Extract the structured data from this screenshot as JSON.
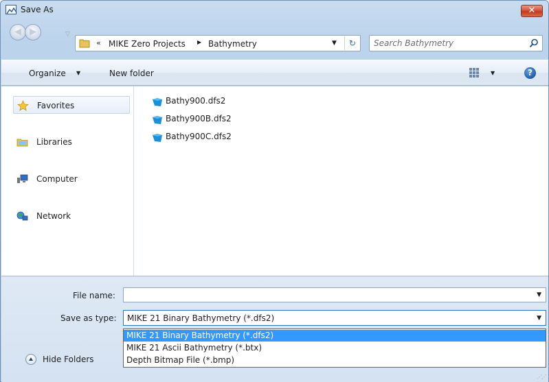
{
  "window": {
    "title": "Save As",
    "close_glyph": "✕",
    "icon": "save-as-app-icon"
  },
  "address": {
    "overflow_glyph": "«",
    "crumbs": [
      "MIKE Zero Projects",
      "Bathymetry"
    ],
    "separator_glyph": "▶",
    "dropdown_glyph": "▼",
    "refresh_glyph": "↻"
  },
  "search": {
    "placeholder": "Search Bathymetry"
  },
  "toolbar": {
    "organize_label": "Organize",
    "organize_arrow": "▼",
    "new_folder_label": "New folder",
    "views_arrow": "▼",
    "help_glyph": "?"
  },
  "nav": {
    "items": [
      {
        "label": "Favorites",
        "icon": "star-icon"
      },
      {
        "label": "Libraries",
        "icon": "libraries-icon"
      },
      {
        "label": "Computer",
        "icon": "computer-icon"
      },
      {
        "label": "Network",
        "icon": "network-icon"
      }
    ]
  },
  "files": [
    {
      "name": "Bathy900.dfs2"
    },
    {
      "name": "Bathy900B.dfs2"
    },
    {
      "name": "Bathy900C.dfs2"
    }
  ],
  "form": {
    "file_name_label": "File name:",
    "file_name_value": "",
    "save_as_type_label": "Save as type:",
    "save_as_type_value": "MIKE 21 Binary Bathymetry (*.dfs2)",
    "dropdown_glyph": "▼",
    "type_options": [
      "MIKE 21 Binary Bathymetry (*.dfs2)",
      "MIKE 21 Ascii Bathymetry (*.btx)",
      "Depth Bitmap File (*.bmp)"
    ],
    "hide_folders_label": "Hide Folders"
  },
  "colors": {
    "selection": "#3399ff",
    "close_button": "#c2391f",
    "file_icon": "#1c8fd6"
  }
}
